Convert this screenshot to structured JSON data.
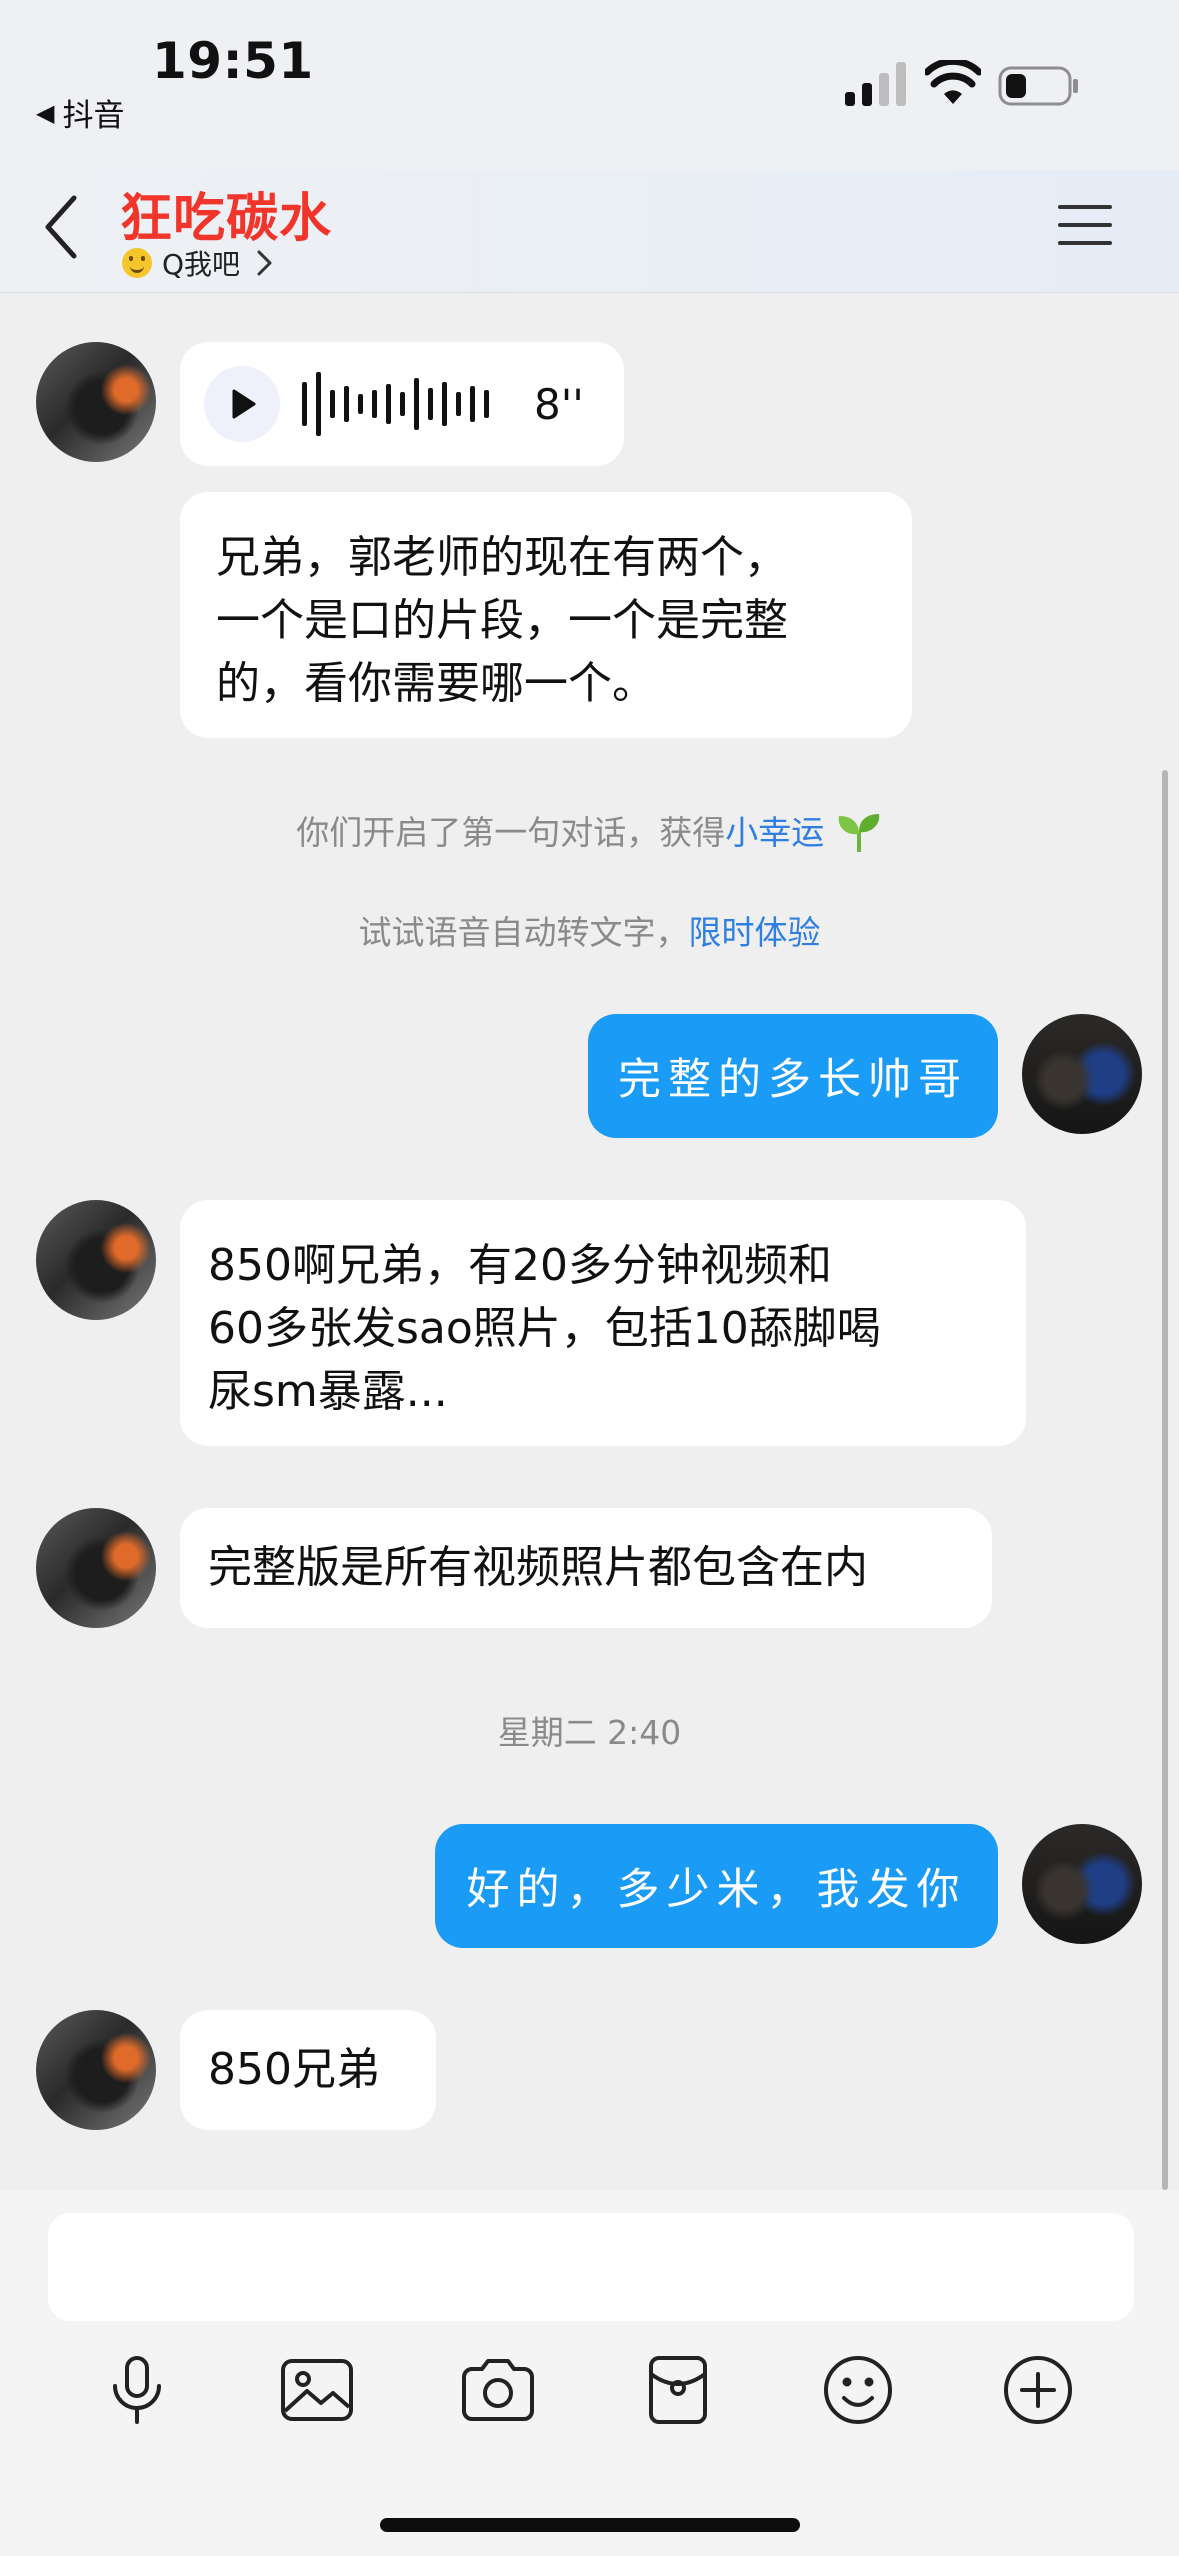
{
  "status_bar": {
    "time": "19:51",
    "back_app": "抖音",
    "icons": [
      "signal-icon",
      "wifi-icon",
      "battery-icon"
    ]
  },
  "header": {
    "back_icon": "chevron-left-icon",
    "title": "狂吃碳水",
    "status_emoji": "smile-emoji-icon",
    "status_text": "Q我吧",
    "status_chevron": "chevron-right-icon",
    "menu_icon": "hamburger-menu-icon"
  },
  "messages": {
    "voice": {
      "duration": "8''",
      "icon": "play-icon"
    },
    "incoming_1": [
      "兄弟，郭老师的现在有两个，",
      "一个是口的片段，一个是完整",
      "的，看你需要哪一个。"
    ],
    "system_1": {
      "text": "你们开启了第一句对话，获得",
      "link": "小幸运",
      "icon": "sprout-icon"
    },
    "system_2": {
      "text": "试试语音自动转文字，",
      "link": "限时体验"
    },
    "outgoing_1": "完整的多长帅哥",
    "incoming_2": [
      "850啊兄弟，有20多分钟视频和",
      "60多张发sao照片，包括10舔脚喝",
      "尿sm暴露..."
    ],
    "incoming_3": "完整版是所有视频照片都包含在内",
    "timestamp": "星期二 2:40",
    "outgoing_2": "好的，多少米，我发你",
    "incoming_4": "850兄弟"
  },
  "input": {
    "placeholder": ""
  },
  "toolbar": {
    "items": [
      "microphone-icon",
      "image-icon",
      "camera-icon",
      "red-packet-icon",
      "emoji-icon",
      "plus-icon"
    ]
  },
  "colors": {
    "title_red": "#f2352a",
    "outgoing_bubble": "#1a9bf5",
    "link_blue": "#2f7fe0",
    "background": "#efefef"
  }
}
